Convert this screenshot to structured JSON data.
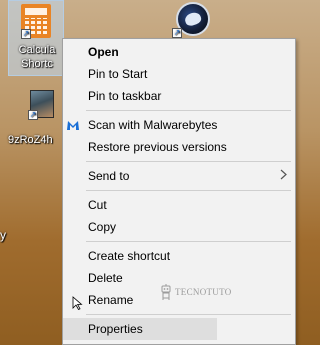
{
  "desktop": {
    "icons": [
      {
        "label": "Calcula Shortc",
        "icon": "calculator-icon"
      },
      {
        "label": "",
        "icon": "round-app-icon"
      },
      {
        "label": "9zRoZ4h",
        "icon": "photo-file-icon"
      },
      {
        "label": "y",
        "icon": "partial-icon"
      }
    ]
  },
  "context_menu": {
    "items": [
      {
        "label": "Open",
        "bold": true
      },
      {
        "label": "Pin to Start"
      },
      {
        "label": "Pin to taskbar"
      },
      {
        "label": "Scan with Malwarebytes",
        "icon": "malwarebytes-icon"
      },
      {
        "label": "Restore previous versions"
      },
      {
        "label": "Send to",
        "submenu": true
      },
      {
        "label": "Cut"
      },
      {
        "label": "Copy"
      },
      {
        "label": "Create shortcut"
      },
      {
        "label": "Delete"
      },
      {
        "label": "Rename"
      },
      {
        "label": "Properties",
        "highlighted": true
      }
    ]
  },
  "watermark": {
    "text": "TECNOTUTO"
  },
  "colors": {
    "menu_bg": "#f2f2f2",
    "menu_border": "#a0a0a0",
    "highlight": "#dedede",
    "desktop_brown": "#a06c2e",
    "malwarebytes_blue": "#1a6fd6"
  }
}
